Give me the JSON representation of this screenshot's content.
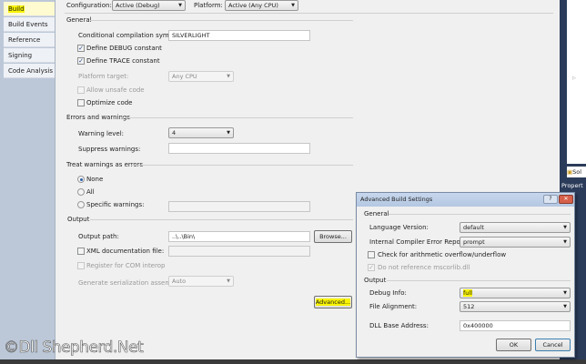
{
  "top": {
    "configuration_label": "Configuration:",
    "configuration_value": "Active (Debug)",
    "platform_label": "Platform:",
    "platform_value": "Active (Any CPU)"
  },
  "tabs": [
    {
      "label": "Build",
      "selected": true
    },
    {
      "label": "Build Events"
    },
    {
      "label": "Reference Paths"
    },
    {
      "label": "Signing"
    },
    {
      "label": "Code Analysis"
    }
  ],
  "general": {
    "title": "General",
    "symbols_label": "Conditional compilation symbols:",
    "symbols_value": "SILVERLIGHT",
    "debug_label": "Define DEBUG constant",
    "debug_checked": true,
    "trace_label": "Define TRACE constant",
    "trace_checked": true,
    "platform_label": "Platform target:",
    "platform_value": "Any CPU",
    "unsafe_label": "Allow unsafe code",
    "optimize_label": "Optimize code"
  },
  "errors": {
    "title": "Errors and warnings",
    "level_label": "Warning level:",
    "level_value": "4",
    "suppress_label": "Suppress warnings:",
    "suppress_value": ""
  },
  "treat": {
    "title": "Treat warnings as errors",
    "none": "None",
    "all": "All",
    "specific": "Specific warnings:",
    "selected": "None"
  },
  "output": {
    "title": "Output",
    "path_label": "Output path:",
    "path_value": "..\\..\\Bin\\",
    "browse": "Browse...",
    "xml_label": "XML documentation file:",
    "com_label": "Register for COM interop",
    "serial_label": "Generate serialization assembly:",
    "serial_value": "Auto",
    "advanced": "Advanced..."
  },
  "right": {
    "solution": "Sol",
    "properties": "Propert"
  },
  "dialog": {
    "title": "Advanced Build Settings",
    "help": "?",
    "close": "✕",
    "general_title": "General",
    "lang_label": "Language Version:",
    "lang_value": "default",
    "ice_label": "Internal Compiler Error Reporting:",
    "ice_value": "prompt",
    "overflow_label": "Check for arithmetic overflow/underflow",
    "mscorlib_label": "Do not reference mscorlib.dll",
    "output_title": "Output",
    "debug_label": "Debug Info:",
    "debug_value": "full",
    "align_label": "File Alignment:",
    "align_value": "512",
    "base_label": "DLL Base Address:",
    "base_value": "0x400000",
    "ok": "OK",
    "cancel": "Cancel"
  },
  "watermark": "©Dll Shepherd.Net"
}
